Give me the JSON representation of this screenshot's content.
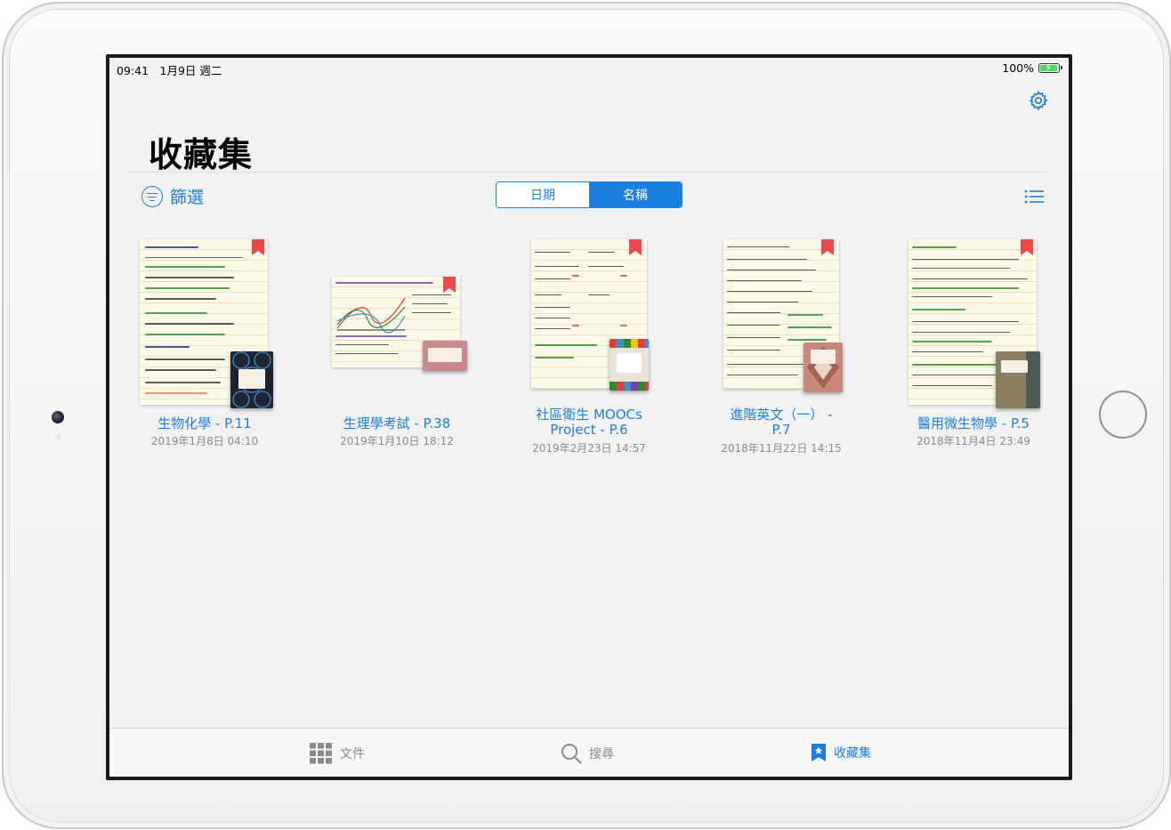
{
  "status": {
    "time_date": "09:41　1月9日 週二",
    "battery": "100%",
    "battery_level": 1.0
  },
  "header": {
    "title": "收藏集",
    "settings_icon": "gear-icon"
  },
  "toolbar": {
    "filter_label": "篩選",
    "sort_options": [
      "日期",
      "名稱"
    ],
    "selected_sort": "名稱",
    "view_icon": "list-icon"
  },
  "items": [
    {
      "title": "生物化學 - P.11",
      "date": "2019年1月8日 04:10",
      "cover_color": "#1f2433",
      "accent": "#3a8fc9"
    },
    {
      "title": "生理學考試 - P.38",
      "date": "2019年1月10日 18:12",
      "cover_color": "#c9898f",
      "accent": "#7a3fa5"
    },
    {
      "title_line1": "社區衛生 MOOCs",
      "title_line2": "Project - P.6",
      "date": "2019年2月23日 14:57",
      "cover_color": "#e9e3da",
      "accent": "#e23c3c"
    },
    {
      "title_line1": "進階英文（一） -",
      "title_line2": "P.7",
      "date": "2018年11月22日 14:15",
      "cover_color": "#c9887a",
      "accent": "#2b8a2b"
    },
    {
      "title": "醫用微生物學 - P.5",
      "date": "2018年11月4日 23:49",
      "cover_color": "#8b7d5f",
      "accent": "#2b8a2b"
    }
  ],
  "tabs": [
    {
      "label": "文件",
      "icon": "grid-icon"
    },
    {
      "label": "搜尋",
      "icon": "search-icon"
    },
    {
      "label": "收藏集",
      "icon": "bookmark-star-icon"
    }
  ],
  "colors": {
    "accent": "#1b7fe0",
    "bookmark": "#f0474f",
    "background": "#f2f2f2"
  }
}
